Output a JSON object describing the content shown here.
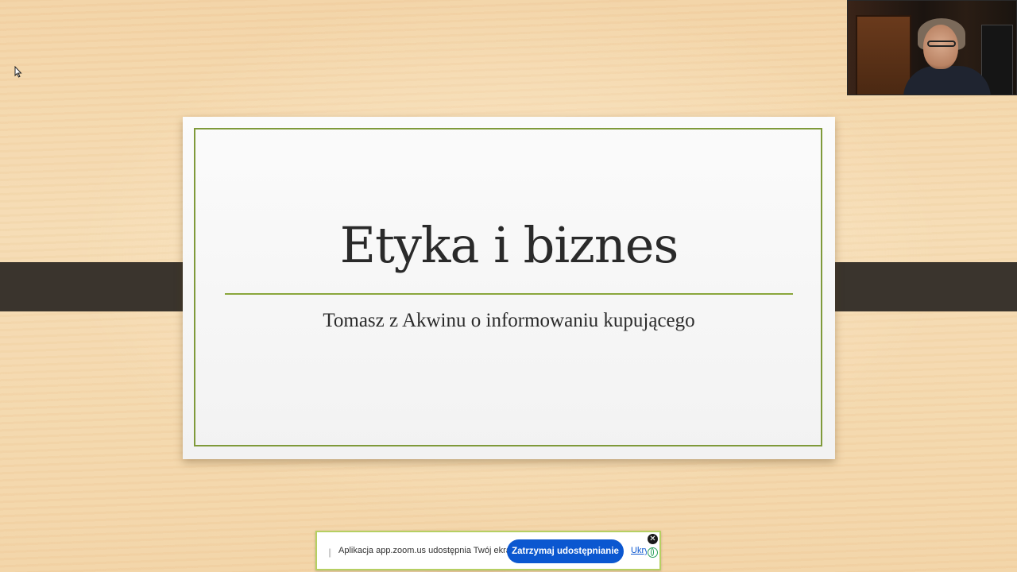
{
  "slide": {
    "title": "Etyka i biznes",
    "subtitle": "Tomasz z Akwinu o informowaniu kupującego",
    "accent_color": "#7f9a3a"
  },
  "share_bar": {
    "message": "Aplikacja app.zoom.us udostępnia Twój ekran.",
    "stop_button_label": "Zatrzymaj udostępnianie",
    "hide_link_label": "Ukryj",
    "button_color": "#0b57d0"
  },
  "icons": {
    "cursor": "mouse-pointer-icon",
    "close": "close-icon",
    "globe": "globe-icon",
    "grip": "drag-handle-icon"
  }
}
